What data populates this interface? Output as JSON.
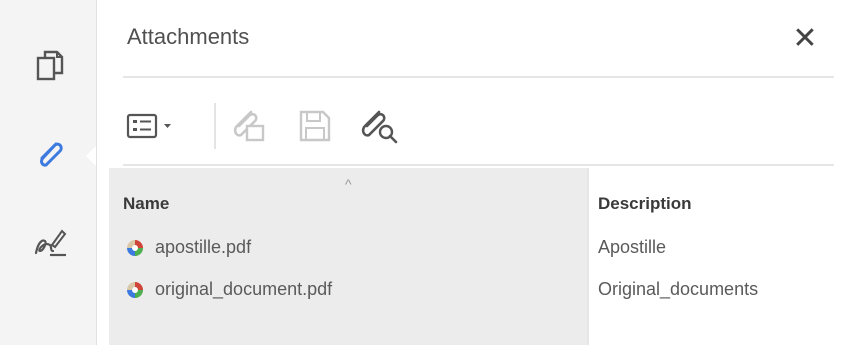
{
  "panel": {
    "title": "Attachments",
    "close_symbol": "✕"
  },
  "left_rail": {
    "items": [
      {
        "icon": "pages-icon",
        "active": false
      },
      {
        "icon": "paperclip-icon",
        "active": true
      },
      {
        "icon": "signature-icon",
        "active": false
      }
    ]
  },
  "toolbar": {
    "buttons": [
      {
        "icon": "options-menu-icon",
        "enabled": true
      },
      {
        "icon": "add-file-icon",
        "enabled": false
      },
      {
        "icon": "save-icon",
        "enabled": false
      },
      {
        "icon": "search-attachment-icon",
        "enabled": true
      }
    ]
  },
  "table": {
    "sort_indicator": "^",
    "columns": [
      "Name",
      "Description"
    ],
    "rows": [
      {
        "name": "apostille.pdf",
        "description": "Apostille"
      },
      {
        "name": "original_document.pdf",
        "description": "Original_documents"
      }
    ]
  },
  "colors": {
    "accent": "#3d7ae0",
    "rail_bg": "#f4f4f4",
    "name_column_bg": "#ececec"
  }
}
